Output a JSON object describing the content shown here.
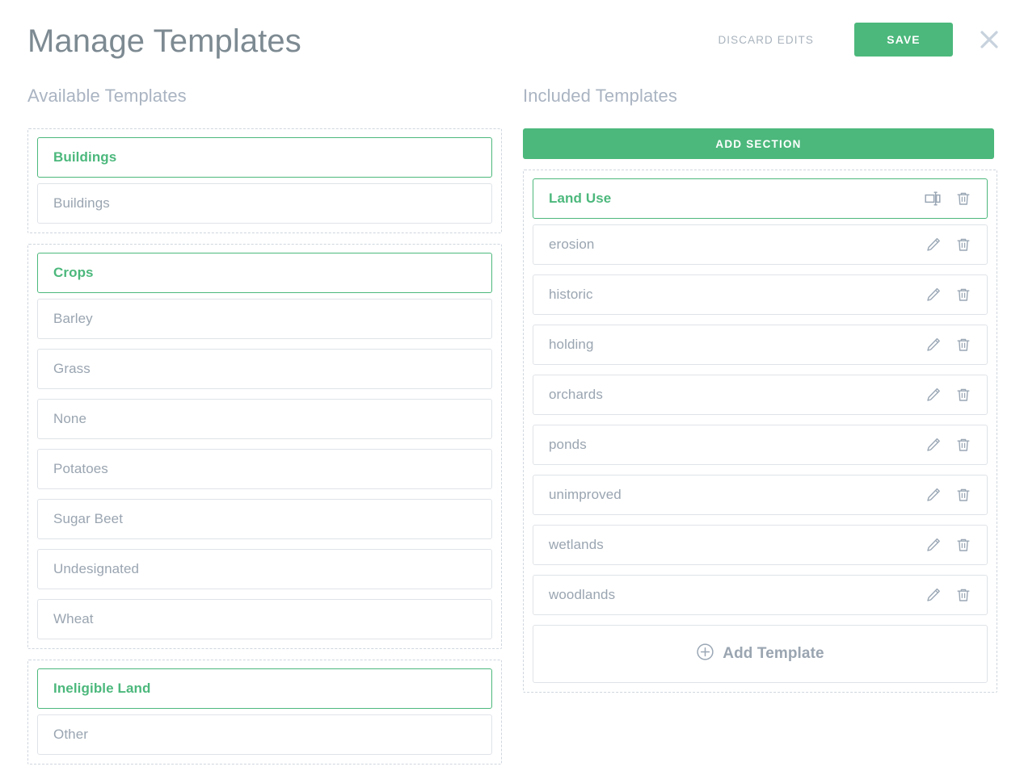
{
  "header": {
    "title": "Manage Templates",
    "discard_label": "Discard Edits",
    "save_label": "Save",
    "close_icon": "close-icon"
  },
  "available": {
    "heading": "Available Templates",
    "groups": [
      {
        "name": "Buildings",
        "items": [
          "Buildings"
        ]
      },
      {
        "name": "Crops",
        "items": [
          "Barley",
          "Grass",
          "None",
          "Potatoes",
          "Sugar Beet",
          "Undesignated",
          "Wheat"
        ]
      },
      {
        "name": "Ineligible Land",
        "items": [
          "Other"
        ]
      }
    ]
  },
  "included": {
    "heading": "Included Templates",
    "add_section_label": "Add Section",
    "sections": [
      {
        "name": "Land Use",
        "rename_icon": "rename-icon",
        "delete_icon": "trash-icon",
        "templates": [
          "erosion",
          "historic",
          "holding",
          "orchards",
          "ponds",
          "unimproved",
          "wetlands",
          "woodlands"
        ],
        "edit_icon": "pencil-icon",
        "row_delete_icon": "trash-icon",
        "add_template_label": "Add Template",
        "add_template_icon": "plus-circle-icon"
      }
    ]
  },
  "colors": {
    "accent_green": "#4cb87c",
    "title_gray": "#7d8a92",
    "heading_gray": "#aab4c2",
    "item_gray": "#9aa5b1",
    "border_gray": "#dfe3e8",
    "dashed_gray": "#cfd6de",
    "icon_gray": "#9aa7b5",
    "close_gray": "#c7d2dd"
  }
}
